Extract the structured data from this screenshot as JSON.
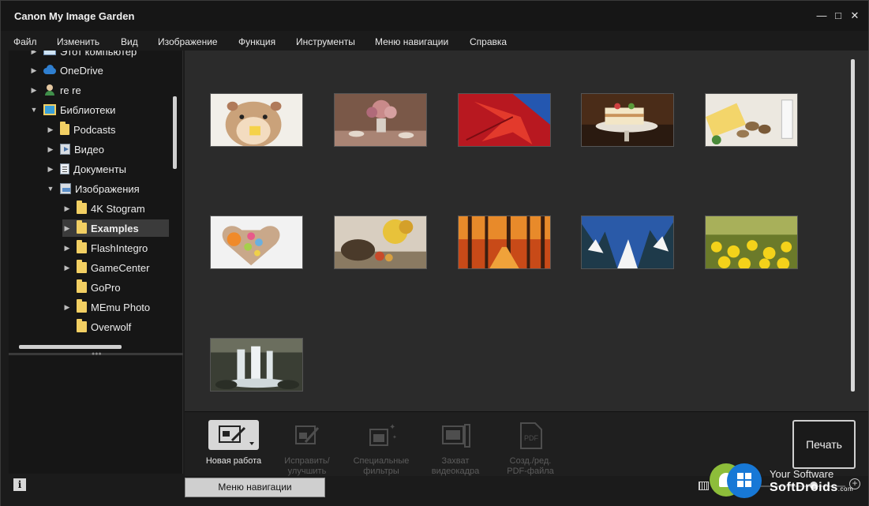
{
  "app": {
    "title": "Canon My Image Garden"
  },
  "window_controls": {
    "minimize": "—",
    "maximize": "□",
    "close": "✕"
  },
  "menu": [
    "Файл",
    "Изменить",
    "Вид",
    "Изображение",
    "Функция",
    "Инструменты",
    "Меню навигации",
    "Справка"
  ],
  "tree": {
    "items": [
      {
        "label": "Этот компьютер",
        "icon": "computer-icon",
        "expandable": true
      },
      {
        "label": "OneDrive",
        "icon": "cloud-icon",
        "expandable": true
      },
      {
        "label": "re re",
        "icon": "user-icon",
        "expandable": true
      },
      {
        "label": "Библиотеки",
        "icon": "library-icon",
        "expandable": true,
        "expanded": true
      },
      {
        "label": "Podcasts",
        "icon": "folder-icon",
        "expandable": true
      },
      {
        "label": "Видео",
        "icon": "video-library-icon",
        "expandable": true
      },
      {
        "label": "Документы",
        "icon": "documents-library-icon",
        "expandable": true
      },
      {
        "label": "Изображения",
        "icon": "images-library-icon",
        "expandable": true,
        "expanded": true
      },
      {
        "label": "4K Stogram",
        "icon": "folder-icon",
        "expandable": true
      },
      {
        "label": "Examples",
        "icon": "folder-icon",
        "expandable": true,
        "selected": true
      },
      {
        "label": "FlashIntegro",
        "icon": "folder-icon",
        "expandable": true
      },
      {
        "label": "GameCenter",
        "icon": "folder-icon",
        "expandable": true
      },
      {
        "label": "GoPro",
        "icon": "folder-icon",
        "expandable": false
      },
      {
        "label": "MEmu Photo",
        "icon": "folder-icon",
        "expandable": true
      },
      {
        "label": "Overwolf",
        "icon": "folder-icon",
        "expandable": false
      }
    ]
  },
  "thumbnails": [
    {
      "subject": "hamster",
      "colors": [
        "#a88262",
        "#e8c9a0",
        "#f3f0ea"
      ]
    },
    {
      "subject": "flowers-tea-still-life",
      "colors": [
        "#6b4a3a",
        "#c79a8a",
        "#d8c2b6"
      ]
    },
    {
      "subject": "red-maple-leaf",
      "colors": [
        "#1c4fa1",
        "#c4141b",
        "#e8382b"
      ]
    },
    {
      "subject": "cake-on-stand",
      "colors": [
        "#3a2414",
        "#f0e2c8",
        "#c9a16a"
      ]
    },
    {
      "subject": "cheese-mushrooms",
      "colors": [
        "#eae6df",
        "#8a6b44",
        "#f2d46a"
      ]
    },
    {
      "subject": "heart-box-sweets",
      "colors": [
        "#efefef",
        "#f08a2a",
        "#c34a6a"
      ]
    },
    {
      "subject": "autumn-still-life",
      "colors": [
        "#4a3a2a",
        "#e8c23a",
        "#c9b6a0"
      ]
    },
    {
      "subject": "autumn-forest",
      "colors": [
        "#3a1e10",
        "#d4561f",
        "#f0a23a"
      ]
    },
    {
      "subject": "winter-forest",
      "colors": [
        "#2a5aa8",
        "#f4f4f4",
        "#1e3a4a"
      ]
    },
    {
      "subject": "dandelion-field",
      "colors": [
        "#6b7a2a",
        "#f4d21a",
        "#a8b05a"
      ]
    },
    {
      "subject": "waterfall",
      "colors": [
        "#2a2e26",
        "#dfe6e8",
        "#6b6e5e"
      ]
    }
  ],
  "toolbar": {
    "tools": [
      {
        "label_line1": "Новая работа",
        "label_line2": "",
        "icon": "new-work-icon",
        "enabled": true
      },
      {
        "label_line1": "Исправить/",
        "label_line2": "улучшить",
        "icon": "fix-enhance-icon",
        "enabled": false
      },
      {
        "label_line1": "Специальные",
        "label_line2": "фильтры",
        "icon": "special-filters-icon",
        "enabled": false
      },
      {
        "label_line1": "Захват",
        "label_line2": "видеокадра",
        "icon": "video-capture-icon",
        "enabled": false
      },
      {
        "label_line1": "Созд./ред.",
        "label_line2": "PDF-файла",
        "icon": "pdf-icon",
        "enabled": false
      }
    ],
    "print_label": "Печать"
  },
  "statusbar": {
    "info_label": "i",
    "nav_menu_label": "Меню навигации",
    "zoom_plus": "+"
  },
  "watermark": {
    "line1": "Your Software",
    "line2": "SoftDroids",
    "suffix": ".com"
  }
}
